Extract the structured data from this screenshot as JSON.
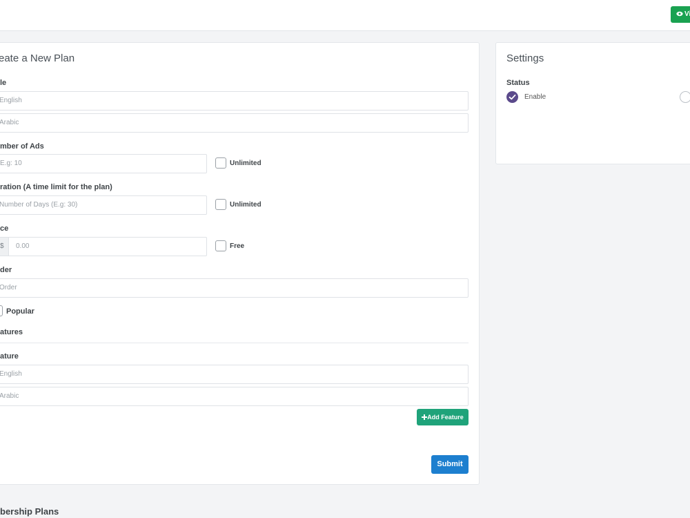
{
  "topbar": {
    "view_button": "Vi"
  },
  "create_form": {
    "title": "eate a New Plan",
    "title_label": "le",
    "title_en_placeholder": "English",
    "title_ar_placeholder": "Arabic",
    "ads_label": "mber of Ads",
    "ads_placeholder": "E.g: 10",
    "ads_unlimited": "Unlimited",
    "duration_label": "ration (A time limit for the plan)",
    "duration_placeholder": "Number of Days  (E.g: 30)",
    "duration_unlimited": "Unlimited",
    "price_label": "ce",
    "price_prefix": "$",
    "price_placeholder": "0.00",
    "price_free": "Free",
    "order_label": "der",
    "order_placeholder": "Order",
    "popular_label": "Popular",
    "features_heading": "atures",
    "feature_label": "ature",
    "feature_en_placeholder": "English",
    "feature_ar_placeholder": "Arabic",
    "add_feature_button": "Add Feature",
    "submit_button": "Submit"
  },
  "settings": {
    "title": "Settings",
    "status_label": "Status",
    "enable_label": "Enable"
  },
  "bottom": {
    "title": "bership Plans"
  }
}
